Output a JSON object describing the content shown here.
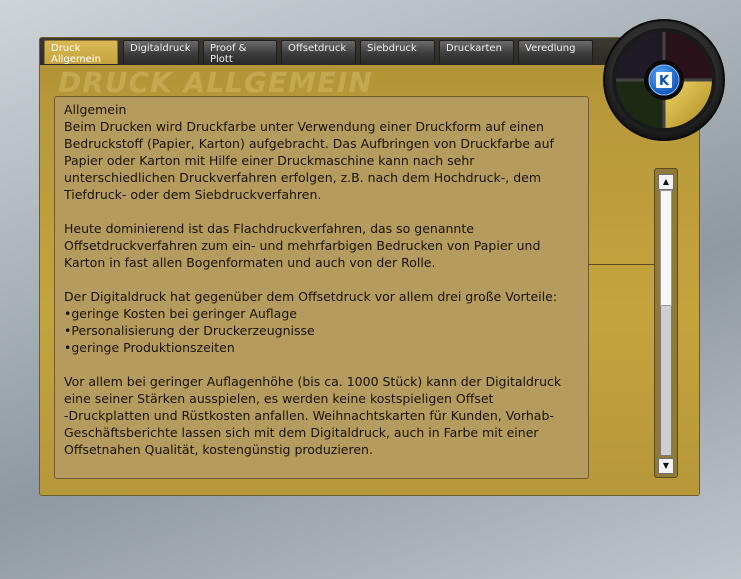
{
  "tabs": [
    {
      "label": "Druck\nAllgemein",
      "active": true
    },
    {
      "label": "Digitaldruck",
      "active": false
    },
    {
      "label": "Proof &\nPlott",
      "active": false
    },
    {
      "label": "Offsetdruck",
      "active": false
    },
    {
      "label": "Siebdruck",
      "active": false
    },
    {
      "label": "Druckarten",
      "active": false
    },
    {
      "label": "Veredlung",
      "active": false
    }
  ],
  "section_title": "DRUCK ALLGEMEIN",
  "content": {
    "p1": "Allgemein\nBeim Drucken wird Druckfarbe unter Verwendung einer Druckform auf einen Bedruckstoff (Papier, Karton) aufgebracht. Das Aufbringen von Druckfarbe auf Papier oder Karton mit Hilfe einer Druckmaschine kann nach sehr unterschiedlichen Druckverfahren erfolgen, z.B. nach dem Hochdruck-, dem Tiefdruck- oder dem Siebdruckverfahren.",
    "p2": "Heute dominierend ist das Flachdruckverfahren, das so genannte Offsetdruckverfahren zum ein- und mehrfarbigen Bedrucken von Papier und Karton in fast allen Bogenformaten und auch von der Rolle.",
    "p3": "Der Digitaldruck hat gegenüber dem Offsetdruck vor allem drei große Vorteile:\n•geringe Kosten bei geringer Auflage\n•Personalisierung der Druckerzeugnisse\n•geringe Produktionszeiten",
    "p4": "Vor allem bei geringer Auflagenhöhe (bis ca. 1000 Stück) kann der Digitaldruck eine seiner Stärken ausspielen, es werden keine kostspieligen Offset\n-Druckplatten und Rüstkosten anfallen. Weihnachtskarten für Kunden, Vorhab-Geschäftsberichte lassen sich mit dem Digitaldruck, auch in Farbe mit einer Offsetnahen Qualität, kostengünstig produzieren."
  },
  "logo": {
    "letter": "K"
  },
  "scrollbar": {
    "up": "▲",
    "down": "▼",
    "position": 0
  },
  "colors": {
    "accent": "#c5a33e",
    "panel": "#b99a3a",
    "logo_blue": "#1a6fd6"
  }
}
